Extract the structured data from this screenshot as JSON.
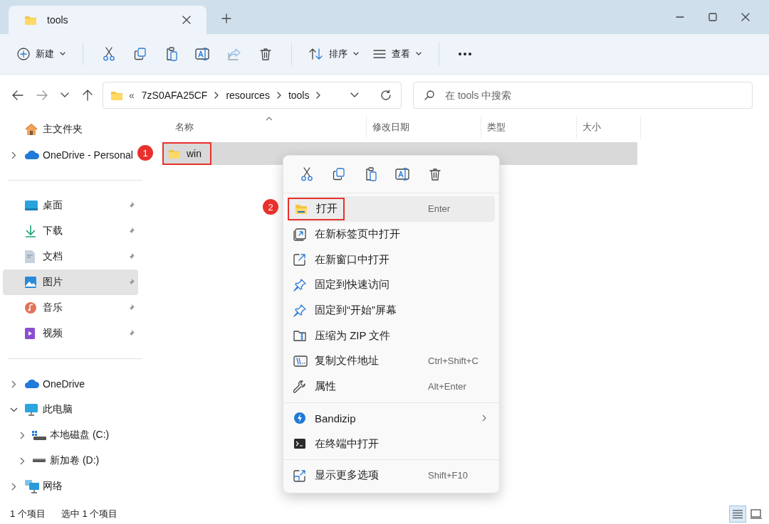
{
  "window": {
    "tabs": [
      {
        "title": "tools",
        "selected": true
      }
    ]
  },
  "toolbar": {
    "groups": [
      [
        {
          "kind": "new",
          "label": "新建"
        }
      ],
      [
        {
          "kind": "cut"
        },
        {
          "kind": "copy"
        },
        {
          "kind": "paste"
        },
        {
          "kind": "rename"
        },
        {
          "kind": "share",
          "disabled": true
        },
        {
          "kind": "delete"
        }
      ],
      [
        {
          "kind": "sort",
          "label": "排序"
        },
        {
          "kind": "view",
          "label": "查看"
        }
      ],
      [
        {
          "kind": "more"
        }
      ]
    ]
  },
  "address_bar": {
    "prefix": "«",
    "path": [
      "7zS0AFA25CF",
      "resources",
      "tools"
    ]
  },
  "search": {
    "placeholder": "在 tools 中搜索"
  },
  "sidebar": {
    "groups": [
      [
        {
          "kind": "home",
          "label": "主文件夹",
          "pinned": false,
          "selected": false
        },
        {
          "kind": "cloud",
          "label": "OneDrive - Personal",
          "expanded": false,
          "pinned": false,
          "selected": false
        }
      ],
      [
        {
          "kind": "desktop",
          "label": "桌面",
          "pinned": true,
          "selected": false
        },
        {
          "kind": "download",
          "label": "下载",
          "pinned": true,
          "selected": false
        },
        {
          "kind": "document",
          "label": "文档",
          "pinned": true,
          "selected": false
        },
        {
          "kind": "pictures",
          "label": "图片",
          "pinned": true,
          "selected": true
        },
        {
          "kind": "music",
          "label": "音乐",
          "pinned": true,
          "selected": false
        },
        {
          "kind": "video",
          "label": "视频",
          "pinned": true,
          "selected": false
        }
      ],
      [
        {
          "kind": "cloud",
          "label": "OneDrive",
          "expanded": false,
          "pinned": false,
          "selected": false
        },
        {
          "kind": "pc",
          "label": "此电脑",
          "expanded": true,
          "pinned": false,
          "selected": false,
          "children": [
            {
              "kind": "system-drive",
              "label": "本地磁盘 (C:)",
              "expanded": false,
              "pinned": false,
              "selected": false
            },
            {
              "kind": "drive",
              "label": "新加卷 (D:)",
              "expanded": false,
              "pinned": false,
              "selected": false
            }
          ]
        },
        {
          "kind": "network",
          "label": "网络",
          "expanded": false,
          "pinned": false,
          "selected": false
        }
      ]
    ]
  },
  "file_list": {
    "columns": [
      {
        "label": "名称",
        "sorted": true
      },
      {
        "label": "修改日期",
        "sorted": false
      },
      {
        "label": "类型",
        "sorted": false
      },
      {
        "label": "大小",
        "sorted": false
      }
    ],
    "rows": [
      {
        "name": "win",
        "selected": true,
        "annotation": {
          "number": "1"
        }
      }
    ]
  },
  "context_menu": {
    "quick_actions": [
      {
        "kind": "cut"
      },
      {
        "kind": "copy"
      },
      {
        "kind": "paste"
      },
      {
        "kind": "rename"
      },
      {
        "kind": "delete"
      }
    ],
    "sections": [
      [
        {
          "kind": "open",
          "label": "打开",
          "shortcut": "Enter",
          "highlighted": true,
          "submenu": false,
          "annotation": {
            "number": "2"
          }
        },
        {
          "kind": "new-tab",
          "label": "在新标签页中打开",
          "highlighted": false,
          "submenu": false
        },
        {
          "kind": "new-window",
          "label": "在新窗口中打开",
          "highlighted": false,
          "submenu": false
        },
        {
          "kind": "pin",
          "label": "固定到快速访问",
          "highlighted": false,
          "submenu": false
        },
        {
          "kind": "pin",
          "label": "固定到“开始”屏幕",
          "highlighted": false,
          "submenu": false
        },
        {
          "kind": "zip",
          "label": "压缩为 ZIP 文件",
          "highlighted": false,
          "submenu": false
        },
        {
          "kind": "copy-path",
          "label": "复制文件地址",
          "shortcut": "Ctrl+Shift+C",
          "highlighted": false,
          "submenu": false
        },
        {
          "kind": "properties",
          "label": "属性",
          "shortcut": "Alt+Enter",
          "highlighted": false,
          "submenu": false
        }
      ],
      [
        {
          "kind": "bandizip",
          "label": "Bandizip",
          "highlighted": false,
          "submenu": true
        },
        {
          "kind": "terminal",
          "label": "在终端中打开",
          "highlighted": false,
          "submenu": false
        }
      ],
      [
        {
          "kind": "more-options",
          "label": "显示更多选项",
          "shortcut": "Shift+F10",
          "highlighted": false,
          "submenu": false
        }
      ]
    ]
  },
  "status_bar": {
    "item_count": "1 个项目",
    "selection": "选中 1 个项目",
    "views": [
      {
        "kind": "details",
        "selected": true
      },
      {
        "kind": "tiles",
        "selected": false
      }
    ]
  }
}
